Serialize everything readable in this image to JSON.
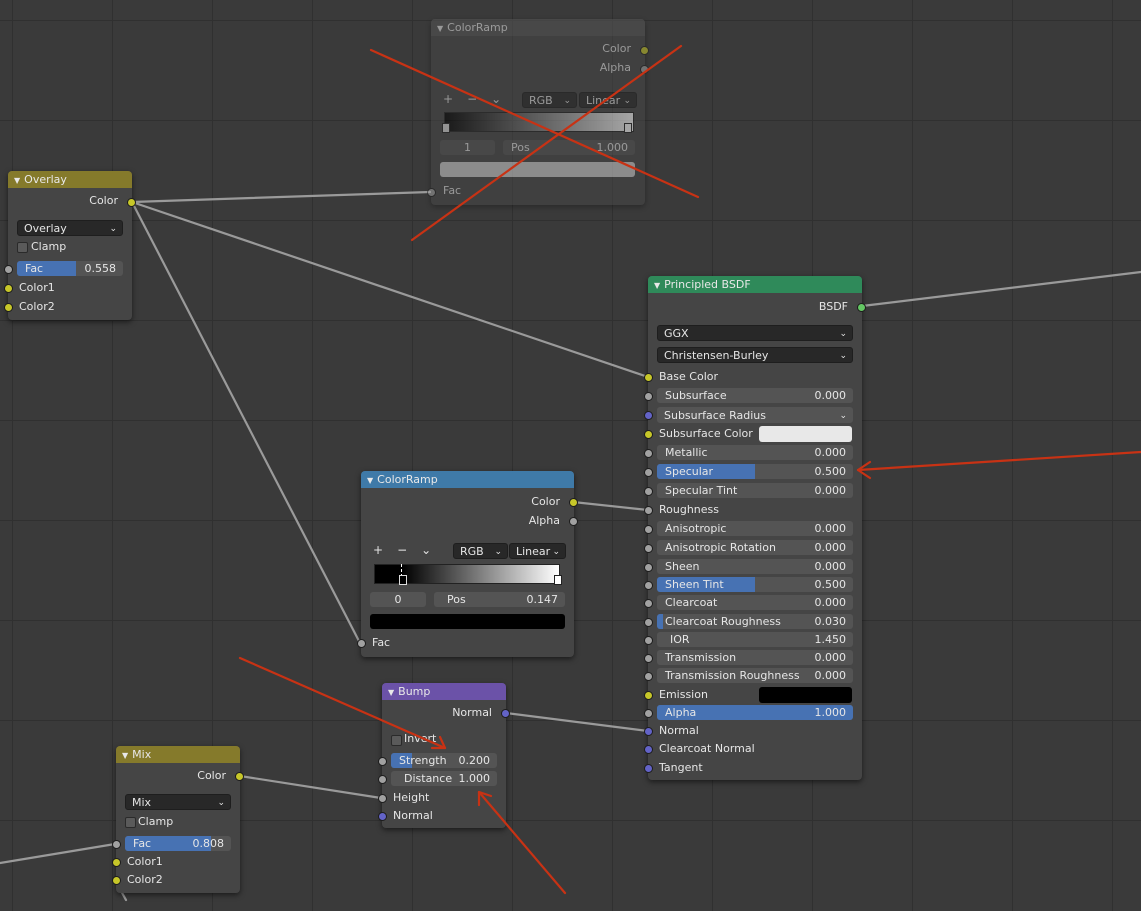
{
  "colors": {
    "header_overlay": "#857a2b",
    "header_colorramp": "#3f7aa8",
    "header_principled": "#2f8a5a",
    "header_bump": "#6b52a8",
    "header_mix": "#857a2b",
    "accent_blue": "#4772b3",
    "annotation_red": "#c83214"
  },
  "colorramp_top": {
    "title": "ColorRamp",
    "out_color": "Color",
    "out_alpha": "Alpha",
    "btn_add": "+",
    "btn_remove": "−",
    "btn_menu": "⌄",
    "color_mode": "RGB",
    "interpolation": "Linear",
    "stop_index": "1",
    "pos_label": "Pos",
    "pos_value": "1.000",
    "in_fac": "Fac",
    "crossed_out": true
  },
  "overlay": {
    "title": "Overlay",
    "out_color": "Color",
    "blend_mode": "Overlay",
    "clamp_label": "Clamp",
    "fac_label": "Fac",
    "fac_value": "0.558",
    "fac_level": 0.558,
    "color1": "Color1",
    "color2": "Color2"
  },
  "principled": {
    "title": "Principled BSDF",
    "out_bsdf": "BSDF",
    "distribution": "GGX",
    "subsurface_method": "Christensen-Burley",
    "base_color": "Base Color",
    "subsurface": {
      "label": "Subsurface",
      "value": "0.000",
      "level": 0
    },
    "subsurface_radius": "Subsurface Radius",
    "subsurface_color": "Subsurface Color",
    "subsurface_color_value": "#e8e8e8",
    "metallic": {
      "label": "Metallic",
      "value": "0.000",
      "level": 0
    },
    "specular": {
      "label": "Specular",
      "value": "0.500",
      "level": 0.5
    },
    "specular_tint": {
      "label": "Specular Tint",
      "value": "0.000",
      "level": 0
    },
    "roughness": "Roughness",
    "anisotropic": {
      "label": "Anisotropic",
      "value": "0.000",
      "level": 0
    },
    "anisotropic_rotation": {
      "label": "Anisotropic Rotation",
      "value": "0.000",
      "level": 0
    },
    "sheen": {
      "label": "Sheen",
      "value": "0.000",
      "level": 0
    },
    "sheen_tint": {
      "label": "Sheen Tint",
      "value": "0.500",
      "level": 0.5
    },
    "clearcoat": {
      "label": "Clearcoat",
      "value": "0.000",
      "level": 0
    },
    "clearcoat_roughness": {
      "label": "Clearcoat Roughness",
      "value": "0.030",
      "level": 0.03
    },
    "ior": {
      "label": "IOR",
      "value": "1.450"
    },
    "transmission": {
      "label": "Transmission",
      "value": "0.000",
      "level": 0
    },
    "transmission_roughness": {
      "label": "Transmission Roughness",
      "value": "0.000",
      "level": 0
    },
    "emission": "Emission",
    "emission_color_value": "#000000",
    "alpha": {
      "label": "Alpha",
      "value": "1.000",
      "level": 1
    },
    "normal": "Normal",
    "clearcoat_normal": "Clearcoat Normal",
    "tangent": "Tangent"
  },
  "colorramp_mid": {
    "title": "ColorRamp",
    "out_color": "Color",
    "out_alpha": "Alpha",
    "btn_add": "+",
    "btn_remove": "−",
    "btn_menu": "⌄",
    "color_mode": "RGB",
    "interpolation": "Linear",
    "stop_index": "0",
    "pos_label": "Pos",
    "pos_value": "0.147",
    "in_fac": "Fac"
  },
  "bump": {
    "title": "Bump",
    "out_normal": "Normal",
    "invert_label": "Invert",
    "strength": {
      "label": "Strength",
      "value": "0.200",
      "level": 0.2
    },
    "distance": {
      "label": "Distance",
      "value": "1.000"
    },
    "height": "Height",
    "normal": "Normal"
  },
  "mix": {
    "title": "Mix",
    "out_color": "Color",
    "blend_mode": "Mix",
    "clamp_label": "Clamp",
    "fac_label": "Fac",
    "fac_value": "0.808",
    "fac_level": 0.808,
    "color1": "Color1",
    "color2": "Color2"
  }
}
